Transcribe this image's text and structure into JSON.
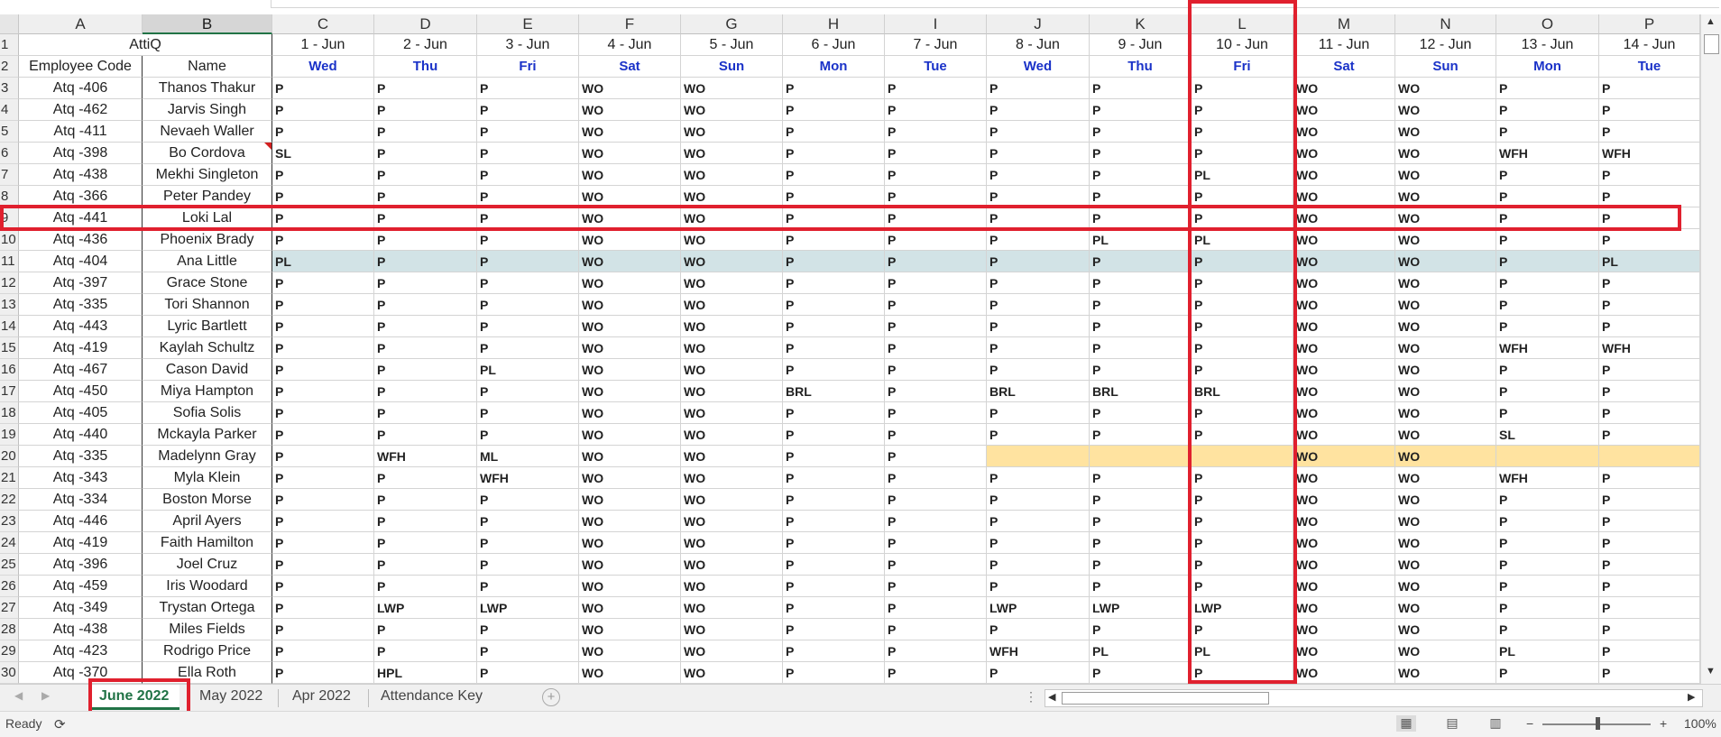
{
  "columns": [
    "A",
    "B",
    "C",
    "D",
    "E",
    "F",
    "G",
    "H",
    "I",
    "J",
    "K",
    "L",
    "M",
    "N",
    "O",
    "P"
  ],
  "selected_column": "B",
  "row1": {
    "title": "AttiQ",
    "dates": [
      "1 - Jun",
      "2 - Jun",
      "3 - Jun",
      "4 - Jun",
      "5 - Jun",
      "6 - Jun",
      "7 - Jun",
      "8 - Jun",
      "9 - Jun",
      "10 - Jun",
      "11 - Jun",
      "12 - Jun",
      "13 - Jun",
      "14 - Jun"
    ]
  },
  "row2": {
    "code_header": "Employee Code",
    "name_header": "Name",
    "days": [
      "Wed",
      "Thu",
      "Fri",
      "Sat",
      "Sun",
      "Mon",
      "Tue",
      "Wed",
      "Thu",
      "Fri",
      "Sat",
      "Sun",
      "Mon",
      "Tue"
    ]
  },
  "employees": [
    {
      "row": "3",
      "code": "Atq -406",
      "name": "Thanos Thakur",
      "v": [
        "P",
        "P",
        "P",
        "WO",
        "WO",
        "P",
        "P",
        "P",
        "P",
        "P",
        "WO",
        "WO",
        "P",
        "P"
      ]
    },
    {
      "row": "4",
      "code": "Atq -462",
      "name": "Jarvis Singh",
      "v": [
        "P",
        "P",
        "P",
        "WO",
        "WO",
        "P",
        "P",
        "P",
        "P",
        "P",
        "WO",
        "WO",
        "P",
        "P"
      ]
    },
    {
      "row": "5",
      "code": "Atq -411",
      "name": "Nevaeh Waller",
      "v": [
        "P",
        "P",
        "P",
        "WO",
        "WO",
        "P",
        "P",
        "P",
        "P",
        "P",
        "WO",
        "WO",
        "P",
        "P"
      ]
    },
    {
      "row": "6",
      "code": "Atq -398",
      "name": "Bo Cordova",
      "v": [
        "SL",
        "P",
        "P",
        "WO",
        "WO",
        "P",
        "P",
        "P",
        "P",
        "P",
        "WO",
        "WO",
        "WFH",
        "WFH"
      ]
    },
    {
      "row": "7",
      "code": "Atq -438",
      "name": "Mekhi Singleton",
      "v": [
        "P",
        "P",
        "P",
        "WO",
        "WO",
        "P",
        "P",
        "P",
        "P",
        "PL",
        "WO",
        "WO",
        "P",
        "P"
      ]
    },
    {
      "row": "8",
      "code": "Atq -366",
      "name": "Peter Pandey",
      "v": [
        "P",
        "P",
        "P",
        "WO",
        "WO",
        "P",
        "P",
        "P",
        "P",
        "P",
        "WO",
        "WO",
        "P",
        "P"
      ]
    },
    {
      "row": "9",
      "code": "Atq -441",
      "name": "Loki Lal",
      "v": [
        "P",
        "P",
        "P",
        "WO",
        "WO",
        "P",
        "P",
        "P",
        "P",
        "P",
        "WO",
        "WO",
        "P",
        "P"
      ]
    },
    {
      "row": "10",
      "code": "Atq -436",
      "name": "Phoenix Brady",
      "v": [
        "P",
        "P",
        "P",
        "WO",
        "WO",
        "P",
        "P",
        "P",
        "PL",
        "PL",
        "WO",
        "WO",
        "P",
        "P"
      ]
    },
    {
      "row": "11",
      "code": "Atq -404",
      "name": "Ana Little",
      "v": [
        "PL",
        "P",
        "P",
        "WO",
        "WO",
        "P",
        "P",
        "P",
        "P",
        "P",
        "WO",
        "WO",
        "P",
        "PL"
      ]
    },
    {
      "row": "12",
      "code": "Atq -397",
      "name": "Grace Stone",
      "v": [
        "P",
        "P",
        "P",
        "WO",
        "WO",
        "P",
        "P",
        "P",
        "P",
        "P",
        "WO",
        "WO",
        "P",
        "P"
      ]
    },
    {
      "row": "13",
      "code": "Atq -335",
      "name": "Tori Shannon",
      "v": [
        "P",
        "P",
        "P",
        "WO",
        "WO",
        "P",
        "P",
        "P",
        "P",
        "P",
        "WO",
        "WO",
        "P",
        "P"
      ]
    },
    {
      "row": "14",
      "code": "Atq -443",
      "name": "Lyric Bartlett",
      "v": [
        "P",
        "P",
        "P",
        "WO",
        "WO",
        "P",
        "P",
        "P",
        "P",
        "P",
        "WO",
        "WO",
        "P",
        "P"
      ]
    },
    {
      "row": "15",
      "code": "Atq -419",
      "name": "Kaylah Schultz",
      "v": [
        "P",
        "P",
        "P",
        "WO",
        "WO",
        "P",
        "P",
        "P",
        "P",
        "P",
        "WO",
        "WO",
        "WFH",
        "WFH"
      ]
    },
    {
      "row": "16",
      "code": "Atq -467",
      "name": "Cason David",
      "v": [
        "P",
        "P",
        "PL",
        "WO",
        "WO",
        "P",
        "P",
        "P",
        "P",
        "P",
        "WO",
        "WO",
        "P",
        "P"
      ]
    },
    {
      "row": "17",
      "code": "Atq -450",
      "name": "Miya Hampton",
      "v": [
        "P",
        "P",
        "P",
        "WO",
        "WO",
        "BRL",
        "P",
        "BRL",
        "BRL",
        "BRL",
        "WO",
        "WO",
        "P",
        "P"
      ]
    },
    {
      "row": "18",
      "code": "Atq -405",
      "name": "Sofia Solis",
      "v": [
        "P",
        "P",
        "P",
        "WO",
        "WO",
        "P",
        "P",
        "P",
        "P",
        "P",
        "WO",
        "WO",
        "P",
        "P"
      ]
    },
    {
      "row": "19",
      "code": "Atq -440",
      "name": "Mckayla Parker",
      "v": [
        "P",
        "P",
        "P",
        "WO",
        "WO",
        "P",
        "P",
        "P",
        "P",
        "P",
        "WO",
        "WO",
        "SL",
        "P"
      ]
    },
    {
      "row": "20",
      "code": "Atq -335",
      "name": "Madelynn Gray",
      "v": [
        "P",
        "WFH",
        "ML",
        "WO",
        "WO",
        "P",
        "P",
        "",
        "",
        "",
        "WO",
        "WO",
        "",
        ""
      ]
    },
    {
      "row": "21",
      "code": "Atq -343",
      "name": "Myla Klein",
      "v": [
        "P",
        "P",
        "WFH",
        "WO",
        "WO",
        "P",
        "P",
        "P",
        "P",
        "P",
        "WO",
        "WO",
        "WFH",
        "P"
      ]
    },
    {
      "row": "22",
      "code": "Atq -334",
      "name": "Boston Morse",
      "v": [
        "P",
        "P",
        "P",
        "WO",
        "WO",
        "P",
        "P",
        "P",
        "P",
        "P",
        "WO",
        "WO",
        "P",
        "P"
      ]
    },
    {
      "row": "23",
      "code": "Atq -446",
      "name": "April Ayers",
      "v": [
        "P",
        "P",
        "P",
        "WO",
        "WO",
        "P",
        "P",
        "P",
        "P",
        "P",
        "WO",
        "WO",
        "P",
        "P"
      ]
    },
    {
      "row": "24",
      "code": "Atq -419",
      "name": "Faith Hamilton",
      "v": [
        "P",
        "P",
        "P",
        "WO",
        "WO",
        "P",
        "P",
        "P",
        "P",
        "P",
        "WO",
        "WO",
        "P",
        "P"
      ]
    },
    {
      "row": "25",
      "code": "Atq -396",
      "name": "Joel Cruz",
      "v": [
        "P",
        "P",
        "P",
        "WO",
        "WO",
        "P",
        "P",
        "P",
        "P",
        "P",
        "WO",
        "WO",
        "P",
        "P"
      ]
    },
    {
      "row": "26",
      "code": "Atq -459",
      "name": "Iris Woodard",
      "v": [
        "P",
        "P",
        "P",
        "WO",
        "WO",
        "P",
        "P",
        "P",
        "P",
        "P",
        "WO",
        "WO",
        "P",
        "P"
      ]
    },
    {
      "row": "27",
      "code": "Atq -349",
      "name": "Trystan Ortega",
      "v": [
        "P",
        "LWP",
        "LWP",
        "WO",
        "WO",
        "P",
        "P",
        "LWP",
        "LWP",
        "LWP",
        "WO",
        "WO",
        "P",
        "P"
      ]
    },
    {
      "row": "28",
      "code": "Atq -438",
      "name": "Miles Fields",
      "v": [
        "P",
        "P",
        "P",
        "WO",
        "WO",
        "P",
        "P",
        "P",
        "P",
        "P",
        "WO",
        "WO",
        "P",
        "P"
      ]
    },
    {
      "row": "29",
      "code": "Atq -423",
      "name": "Rodrigo Price",
      "v": [
        "P",
        "P",
        "P",
        "WO",
        "WO",
        "P",
        "P",
        "WFH",
        "PL",
        "PL",
        "WO",
        "WO",
        "PL",
        "P"
      ]
    },
    {
      "row": "30",
      "code": "Atq -370",
      "name": "Ella Roth",
      "v": [
        "P",
        "HPL",
        "P",
        "WO",
        "WO",
        "P",
        "P",
        "P",
        "P",
        "P",
        "WO",
        "WO",
        "P",
        "P"
      ]
    }
  ],
  "row_highlights": {
    "11": {
      "from": 2,
      "to": 15,
      "color": "#d2e3e6"
    },
    "20": {
      "from": 9,
      "to": 15,
      "color": "#ffe3a0"
    }
  },
  "colors": {
    "highlight_box": "#e0202e",
    "day_text": "#1a32c8",
    "active_tab": "#217346"
  },
  "tabs": [
    "June 2022",
    "May 2022",
    "Apr 2022",
    "Attendance Key"
  ],
  "active_tab": "June 2022",
  "status": {
    "ready": "Ready",
    "zoom": "100%"
  }
}
